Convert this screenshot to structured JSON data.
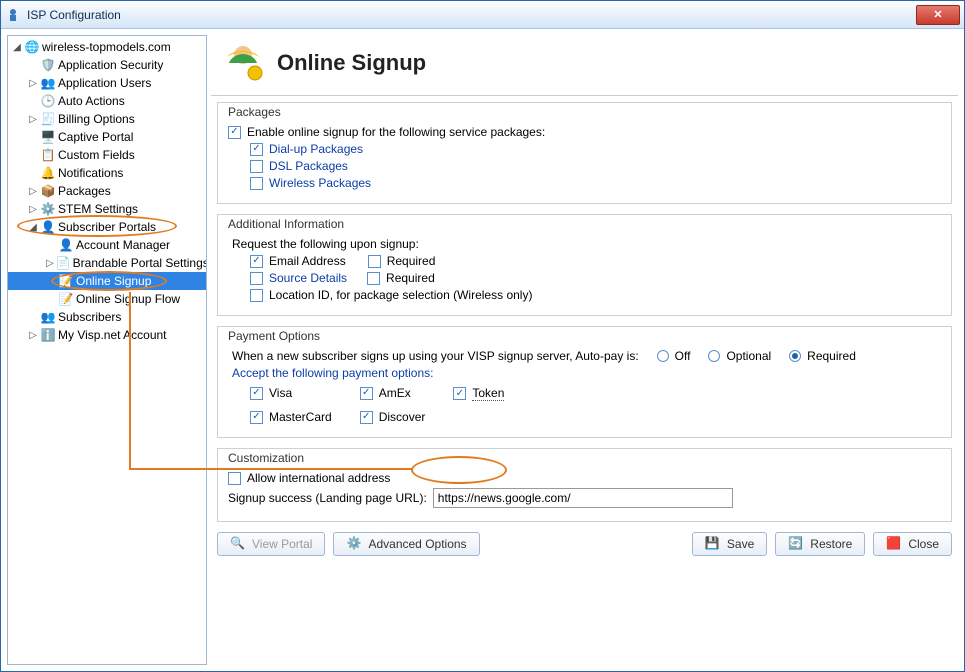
{
  "window": {
    "title": "ISP Configuration"
  },
  "tree": {
    "root": "wireless-topmodels.com",
    "items": [
      "Application Security",
      "Application Users",
      "Auto Actions",
      "Billing Options",
      "Captive Portal",
      "Custom Fields",
      "Notifications",
      "Packages",
      "STEM Settings",
      "Subscriber Portals",
      "Subscribers",
      "My Visp.net Account"
    ],
    "portals_children": [
      "Account Manager",
      "Brandable Portal Settings",
      "Online Signup",
      "Online Signup Flow"
    ]
  },
  "page": {
    "title": "Online Signup"
  },
  "packages": {
    "label": "Packages",
    "enable": "Enable online signup for the following service packages:",
    "dialup": "Dial-up Packages",
    "dsl": "DSL Packages",
    "wireless": "Wireless Packages"
  },
  "addl": {
    "label": "Additional Information",
    "request": "Request the following upon signup:",
    "email": "Email Address",
    "required": "Required",
    "source": "Source Details",
    "locid": "Location ID, for package selection (Wireless only)"
  },
  "payment": {
    "label": "Payment Options",
    "autopay": "When a new subscriber signs up using your VISP signup server, Auto-pay is:",
    "off": "Off",
    "optional": "Optional",
    "req": "Required",
    "accept": "Accept the following payment options:",
    "visa": "Visa",
    "amex": "AmEx",
    "token": "Token",
    "mc": "MasterCard",
    "disc": "Discover"
  },
  "custom": {
    "label": "Customization",
    "intl": "Allow international address",
    "landing_label": "Signup success (Landing page URL):",
    "landing_value": "https://news.google.com/"
  },
  "buttons": {
    "view": "View Portal",
    "adv": "Advanced Options",
    "save": "Save",
    "restore": "Restore",
    "close": "Close"
  }
}
